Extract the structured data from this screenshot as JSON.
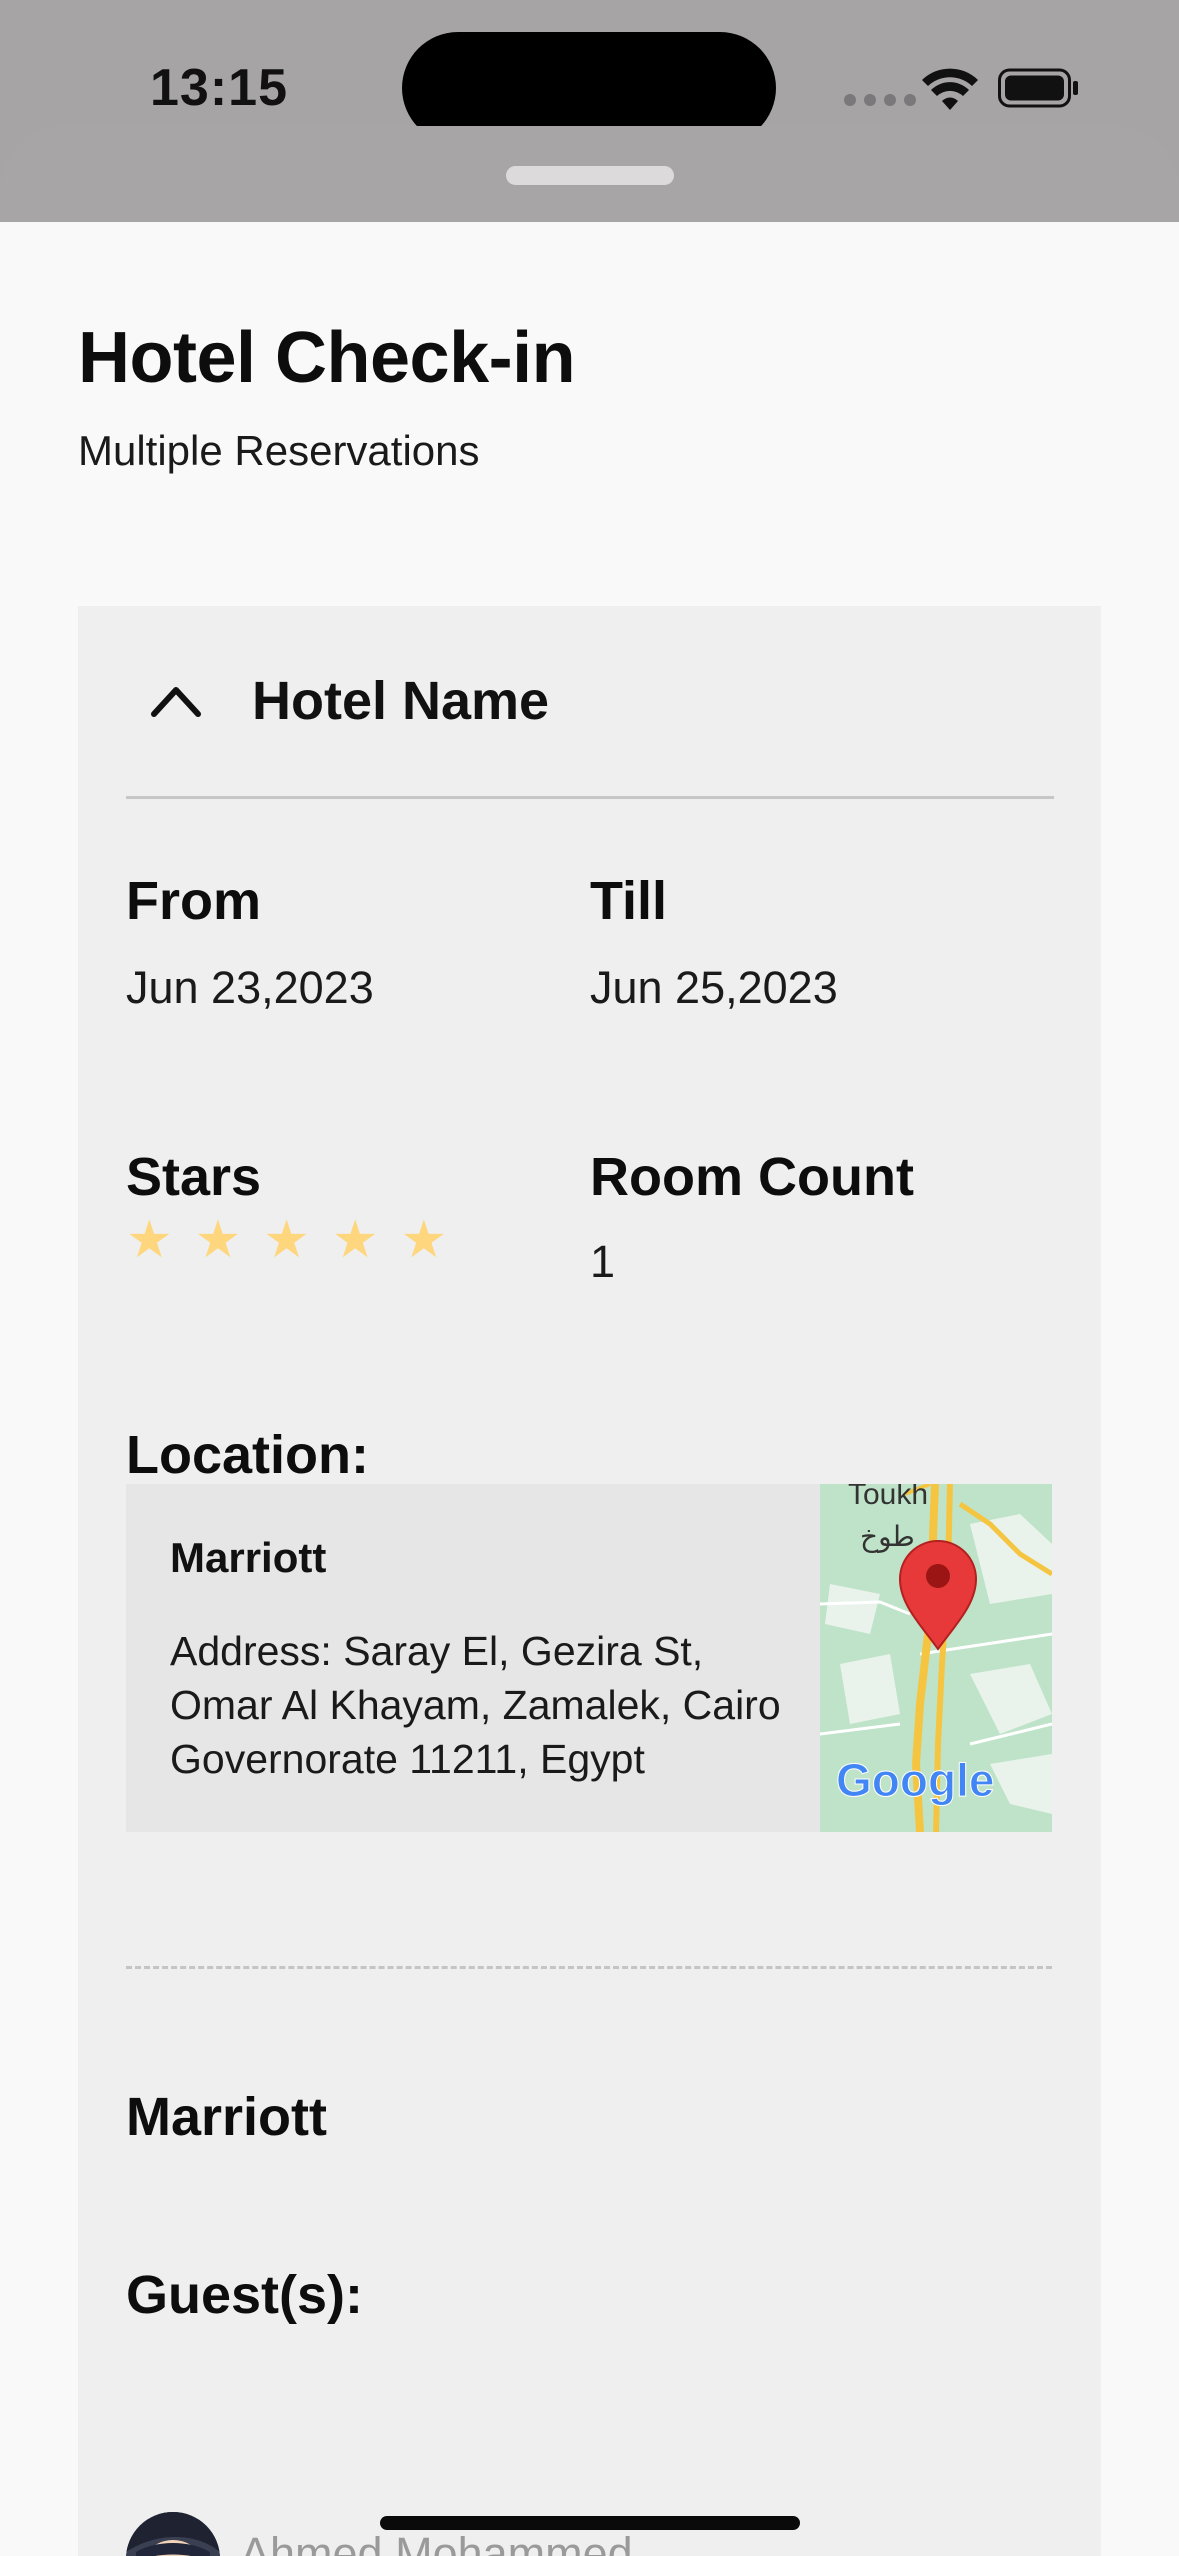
{
  "status_bar": {
    "time": "13:15",
    "icons": [
      "cellular-dots-icon",
      "wifi-icon",
      "battery-icon"
    ]
  },
  "header": {
    "title": "Hotel Check-in",
    "subtitle": "Multiple Reservations"
  },
  "card": {
    "header_title": "Hotel Name",
    "expanded": true,
    "from_label": "From",
    "from_value": "Jun 23,2023",
    "till_label": "Till",
    "till_value": "Jun 25,2023",
    "stars_label": "Stars",
    "stars_rating": 5,
    "stars_max": 5,
    "room_count_label": "Room Count",
    "room_count_value": "1",
    "location_label": "Location:",
    "location": {
      "name": "Marriott",
      "address": "Address: Saray El, Gezira St, Omar Al Khayam, Zamalek, Cairo Governorate 11211, Egypt",
      "map_label_top": "Toukh",
      "map_label_arabic": "طوخ",
      "map_brand": "Google"
    },
    "hotel_name": "Marriott",
    "guests_label": "Guest(s):",
    "guests": [
      {
        "name": "Ahmed Mohammed"
      }
    ]
  },
  "colors": {
    "star": "#fed67e",
    "card_bg": "#efefef",
    "page_bg": "#f9f9f9",
    "map_pin": "#e8393a",
    "map_green": "#bfe3c8",
    "map_road": "#f5c542"
  }
}
